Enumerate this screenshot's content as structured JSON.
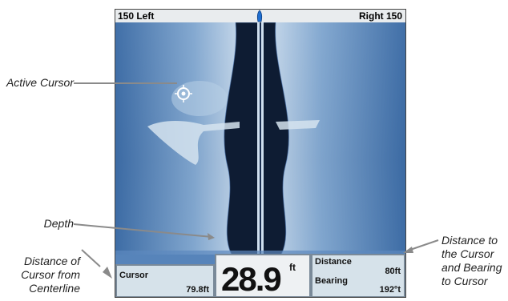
{
  "top_bar": {
    "left_label": "150 Left",
    "right_label": "Right 150"
  },
  "cursor_box": {
    "label": "Cursor",
    "value": "79.8ft"
  },
  "depth_box": {
    "value": "28.9",
    "unit": "ft"
  },
  "distance_box": {
    "distance_label": "Distance",
    "distance_value": "80ft",
    "bearing_label": "Bearing",
    "bearing_value": "192°t"
  },
  "callouts": {
    "active_cursor": "Active Cursor",
    "depth": "Depth",
    "distance_from_centerline": [
      "Distance of",
      "Cursor from",
      "Centerline"
    ],
    "distance_and_bearing": [
      "Distance to",
      "the Cursor",
      "and Bearing",
      "to Cursor"
    ]
  },
  "colors": {
    "sonar_water": "#3f6fa6",
    "sonar_bright": "#c9dcee",
    "panel_bg": "#d6e2ea",
    "leader_line": "#8a8a8a"
  }
}
